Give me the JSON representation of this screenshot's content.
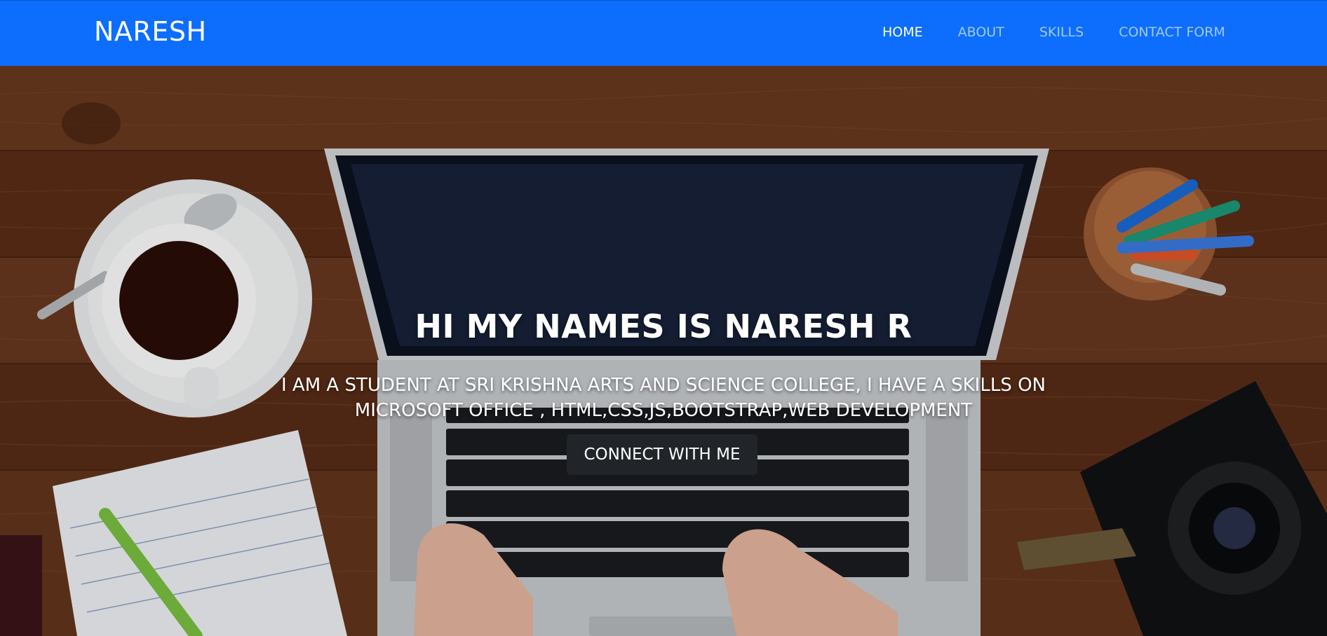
{
  "navbar": {
    "brand": "NARESH",
    "links": [
      {
        "label": "HOME",
        "active": true
      },
      {
        "label": "ABOUT",
        "active": false
      },
      {
        "label": "SKILLS",
        "active": false
      },
      {
        "label": "CONTACT FORM",
        "active": false
      }
    ]
  },
  "hero": {
    "title": "HI MY NAMES IS NARESH R",
    "subtitle": "I AM A STUDENT AT SRI KRISHNA ARTS AND SCIENCE COLLEGE, I HAVE A SKILLS ON MICROSOFT OFFICE , HTML,CSS,JS,BOOTSTRAP,WEB DEVELOPMENT",
    "cta_label": "CONNECT WITH ME"
  },
  "colors": {
    "navbar_bg": "#0d6efd",
    "button_bg": "#212529",
    "text": "#ffffff"
  }
}
